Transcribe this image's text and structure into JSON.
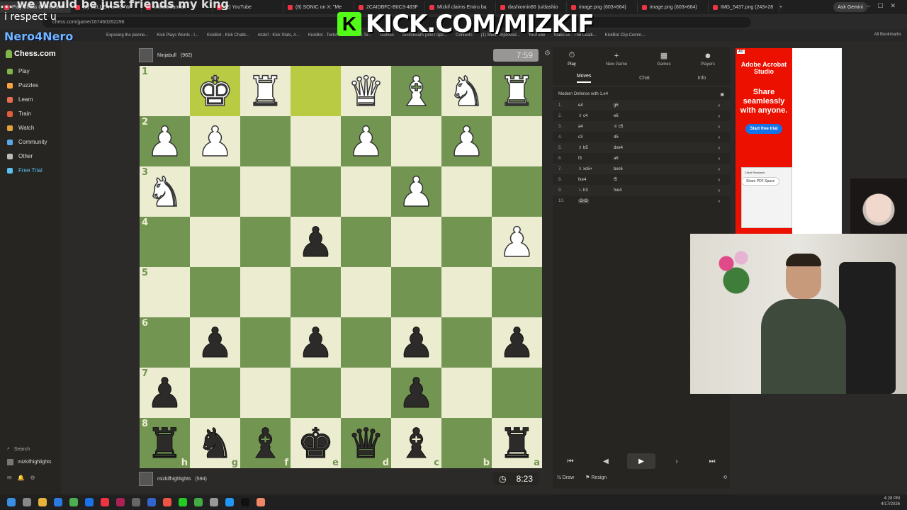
{
  "browser": {
    "tabs": [
      {
        "label": "Play Chess Online for F",
        "active": true
      },
      {
        "label": "(9) VELLEN on X: \"W",
        "active": false
      },
      {
        "label": "r/livestreamfail",
        "active": false
      },
      {
        "label": "(2) YouTube",
        "active": false
      },
      {
        "label": "(8) SONIC on X: \"Me",
        "active": false
      },
      {
        "label": "2CAIDBFC-B0C3-483F",
        "active": false
      },
      {
        "label": "Mizkif claims Emiru ba",
        "active": false
      },
      {
        "label": "dashiomin66 (u/dashio",
        "active": false
      },
      {
        "label": "image.png (603×664)",
        "active": false
      },
      {
        "label": "image.png (603×664)",
        "active": false
      },
      {
        "label": "IMG_5437.png (243×28",
        "active": false
      }
    ],
    "ask_gemini": "Ask Gemini",
    "url": "chess.com/game/167460262296",
    "bookmarks": [
      "Exposing the planne...",
      "Kick Plays Words - I...",
      "KickBot - Kick Chatb...",
      "mizkif - Kick Stats, A...",
      "KickBot - Twitch",
      "Media & Te...",
      "Games",
      "clickstream (don't ope...",
      "Contexts",
      "(1) Much improved...",
      "YouTube",
      "Stake.us - The Leadi...",
      "KickBot Clip Comm..."
    ],
    "all_bookmarks": "All Bookmarks"
  },
  "overlay": {
    "caption": "... we would be just friends my king",
    "respect": "i respect u",
    "kick_logo": "K",
    "kick_url": "KICK.COM/MIZKIF",
    "nero": "Nero4Nero"
  },
  "sidebar": {
    "logo": "Chess.com",
    "items": [
      {
        "label": "Play",
        "color": "#81b64c"
      },
      {
        "label": "Puzzles",
        "color": "#f6a441"
      },
      {
        "label": "Learn",
        "color": "#e76f51"
      },
      {
        "label": "Train",
        "color": "#e05d3a"
      },
      {
        "label": "Watch",
        "color": "#e4a23a"
      },
      {
        "label": "Community",
        "color": "#5aa9e6"
      },
      {
        "label": "Other",
        "color": "#bbbbbb"
      },
      {
        "label": "Free Trial",
        "color": "#59c0f0"
      }
    ],
    "search": "Search",
    "user": "mizkifhighlights"
  },
  "game": {
    "top_player": {
      "name": "Ninjabull",
      "rating": "(962)",
      "clock": "7:59"
    },
    "bottom_player": {
      "name": "mizkifhighlights",
      "rating": "(594)",
      "clock": "8:23"
    },
    "board": [
      [
        "",
        "wK",
        "wR",
        "",
        "wQ",
        "wB",
        "wN",
        "wR"
      ],
      [
        "wP",
        "wP",
        "",
        "",
        "wP",
        "",
        "wP",
        ""
      ],
      [
        "wN",
        "",
        "",
        "",
        "",
        "wP",
        "",
        ""
      ],
      [
        "",
        "",
        "",
        "bP",
        "",
        "",
        "",
        "wP"
      ],
      [
        "",
        "",
        "",
        "",
        "",
        "",
        "",
        ""
      ],
      [
        "",
        "bP",
        "",
        "bP",
        "",
        "bP",
        "",
        "bP"
      ],
      [
        "bP",
        "",
        "",
        "",
        "",
        "bP",
        "",
        ""
      ],
      [
        "bR",
        "bN",
        "bB",
        "bK",
        "bQ",
        "bB",
        "",
        "bR"
      ]
    ],
    "highlights": [
      [
        0,
        1
      ],
      [
        0,
        3
      ]
    ],
    "rank_labels": [
      "1",
      "2",
      "3",
      "4",
      "5",
      "6",
      "7",
      "8"
    ],
    "file_labels": [
      "h",
      "g",
      "f",
      "e",
      "d",
      "c",
      "b",
      "a"
    ]
  },
  "panel": {
    "tabs": [
      {
        "label": "Play",
        "icon": "⏱",
        "active": true
      },
      {
        "label": "New Game",
        "icon": "+",
        "active": false
      },
      {
        "label": "Games",
        "icon": "▦",
        "active": false
      },
      {
        "label": "Players",
        "icon": "☻",
        "active": false
      }
    ],
    "subtabs": [
      "Moves",
      "Chat",
      "Info"
    ],
    "opening": "Modern Defense with 1.e4",
    "moves": [
      {
        "n": "1.",
        "w": "e4",
        "b": "g6"
      },
      {
        "n": "2.",
        "w": "♗ c4",
        "b": "e6"
      },
      {
        "n": "3.",
        "w": "a4",
        "b": "♕ c5"
      },
      {
        "n": "4.",
        "w": "c3",
        "b": "d5"
      },
      {
        "n": "5.",
        "w": "♗ b5",
        "b": "dxe4"
      },
      {
        "n": "6.",
        "w": "f3",
        "b": "a6"
      },
      {
        "n": "7.",
        "w": "♗ xc6+",
        "b": "bxc6"
      },
      {
        "n": "8.",
        "w": "fxe4",
        "b": "f5"
      },
      {
        "n": "9.",
        "w": "♘ h3",
        "b": "fxe4"
      },
      {
        "n": "10.",
        "w": "O-O",
        "b": ""
      }
    ],
    "draw": "Draw",
    "resign": "Resign"
  },
  "ad": {
    "tag": "AD",
    "brand": "Adobe Acrobat Studio",
    "headline": "Share seamlessly with anyone.",
    "cta": "Start free trial",
    "card_title": "Client Research",
    "pill": "Share PDF Space"
  },
  "tray": {
    "time": "4:28 PM",
    "date": "4/17/2026"
  }
}
